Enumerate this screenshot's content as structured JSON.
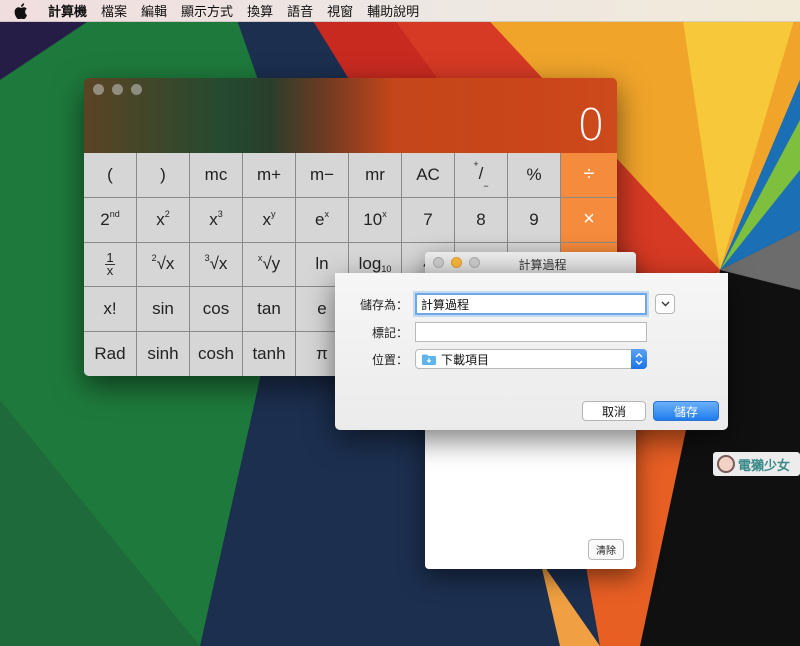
{
  "menubar": {
    "items": [
      "計算機",
      "檔案",
      "編輯",
      "顯示方式",
      "換算",
      "語音",
      "視窗",
      "輔助說明"
    ]
  },
  "calculator": {
    "display_value": "0",
    "colors": {
      "operator": "#f58b3c",
      "key": "#d6d6d6"
    }
  },
  "tape": {
    "title": "計算過程",
    "clear_label": "清除"
  },
  "save_sheet": {
    "save_as_label": "儲存為：",
    "save_as_value": "計算過程",
    "tags_label": "標記：",
    "tags_value": "",
    "where_label": "位置：",
    "where_value": "下載項目",
    "cancel_label": "取消",
    "save_label": "儲存",
    "accent": "#1f7ceb"
  },
  "watermark": {
    "text": "電獺少女"
  }
}
